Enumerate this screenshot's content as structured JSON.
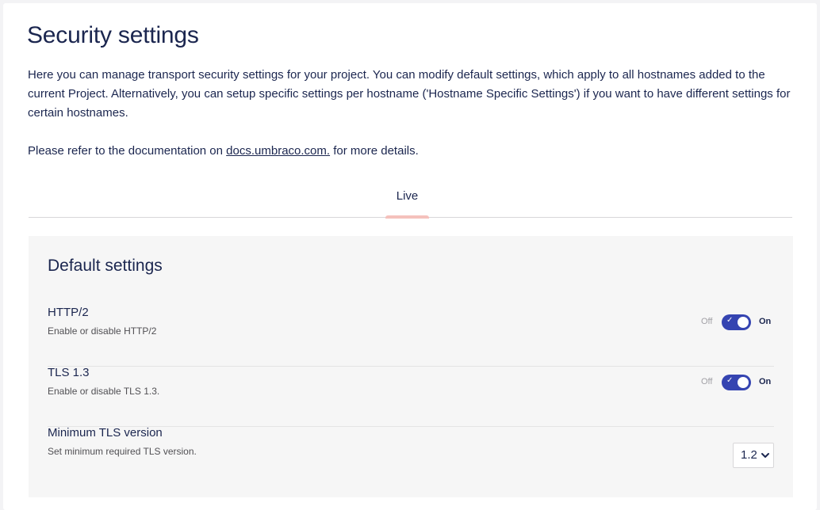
{
  "header": {
    "title": "Security settings",
    "intro": "Here you can manage transport security settings for your project. You can modify default settings, which apply to all hostnames added to the current Project. Alternatively, you can setup specific settings per hostname ('Hostname Specific Settings') if you want to have different settings for certain hostnames.",
    "refer_prefix": "Please refer to the documentation on ",
    "refer_link": "docs.umbraco.com.",
    "refer_suffix": " for more details."
  },
  "tabs": [
    {
      "label": "Live",
      "active": true
    }
  ],
  "panel": {
    "title": "Default settings",
    "settings": [
      {
        "label": "HTTP/2",
        "description": "Enable or disable HTTP/2",
        "off_label": "Off",
        "on_label": "On",
        "enabled": true
      },
      {
        "label": "TLS 1.3",
        "description": "Enable or disable TLS 1.3.",
        "off_label": "Off",
        "on_label": "On",
        "enabled": true
      },
      {
        "label": "Minimum TLS version",
        "description": "Set minimum required TLS version.",
        "selected_value": "1.2"
      }
    ]
  },
  "colors": {
    "text": "#1b264f",
    "toggle_on": "#3544b1",
    "tab_indicator": "#f5c1bc",
    "panel_bg": "#f6f6f6"
  },
  "icons": {
    "toggle_check": "check-icon",
    "select_chevron": "chevron-down-icon"
  }
}
